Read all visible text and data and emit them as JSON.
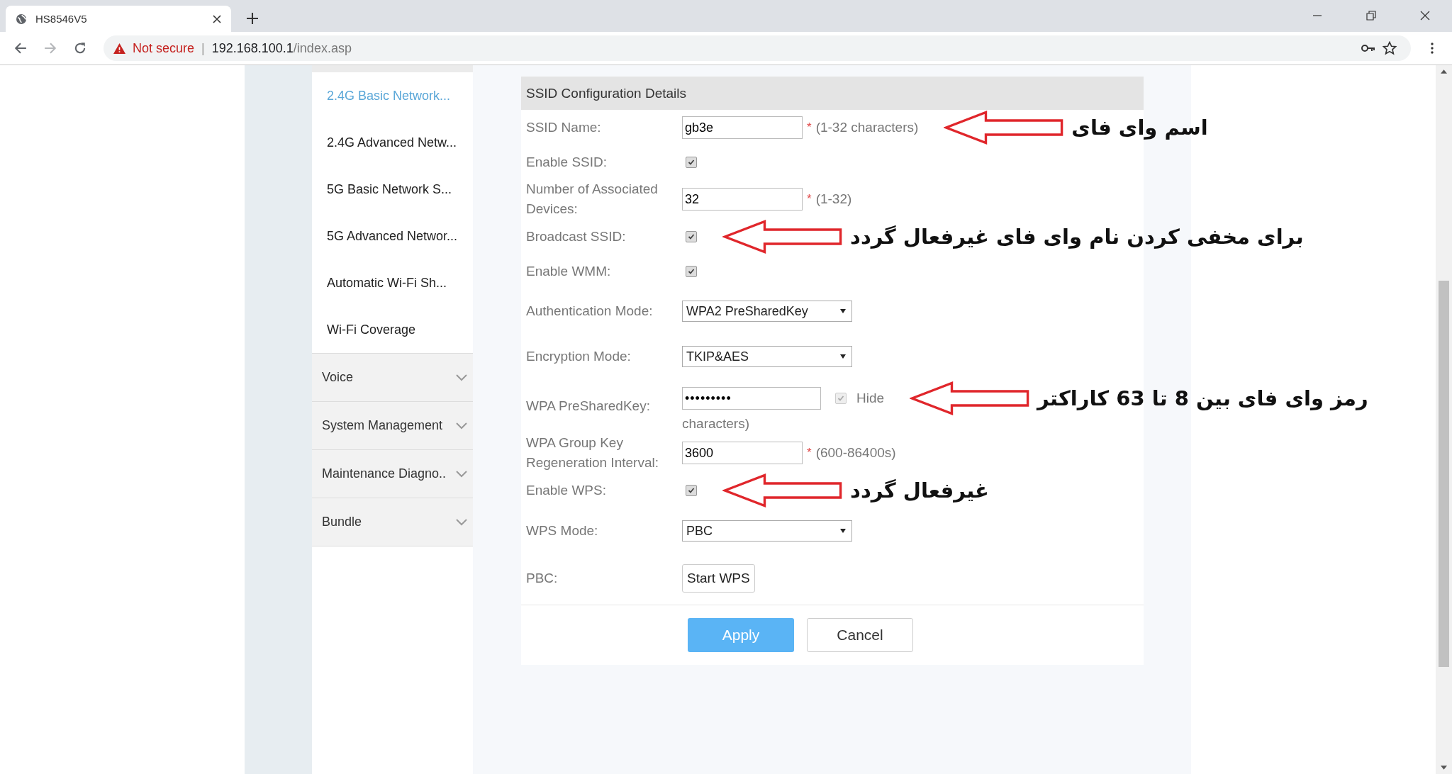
{
  "browser": {
    "tab_title": "HS8546V5",
    "security": "Not secure",
    "separator": "|",
    "url": {
      "host": "192.168.100.1",
      "path": "/index.asp"
    }
  },
  "sidebar": {
    "items": [
      {
        "label": "2.4G Basic Network...",
        "selected": true
      },
      {
        "label": "2.4G Advanced Netw...",
        "selected": false
      },
      {
        "label": "5G Basic Network S...",
        "selected": false
      },
      {
        "label": "5G Advanced Networ...",
        "selected": false
      },
      {
        "label": "Automatic Wi-Fi Sh...",
        "selected": false
      },
      {
        "label": "Wi-Fi Coverage",
        "selected": false
      }
    ],
    "groups": [
      {
        "label": "Voice",
        "expanded": false
      },
      {
        "label": "System Management",
        "expanded": false
      },
      {
        "label": "Maintenance Diagno..",
        "expanded": false
      },
      {
        "label": "Bundle",
        "expanded": false
      }
    ]
  },
  "form": {
    "title": "SSID Configuration Details",
    "fields": [
      {
        "kind": "text",
        "label": "SSID Name:",
        "value": "gb3e",
        "required": "*",
        "hint": "(1-32 characters)",
        "note": "اسم وای فای"
      },
      {
        "kind": "checkbox",
        "label": "Enable SSID:",
        "checked": true
      },
      {
        "kind": "text",
        "label": "Number of Associated Devices:",
        "value": "32",
        "required": "*",
        "hint": "(1-32)"
      },
      {
        "kind": "checkbox",
        "label": "Broadcast SSID:",
        "checked": true,
        "note": "برای مخفی کردن نام وای فای غیرفعال گردد"
      },
      {
        "kind": "checkbox",
        "label": "Enable WMM:",
        "checked": true
      },
      {
        "kind": "select",
        "label": "Authentication Mode:",
        "value": "WPA2 PreSharedKey"
      },
      {
        "kind": "select",
        "label": "Encryption Mode:",
        "value": "TKIP&AES"
      },
      {
        "kind": "password",
        "label": "WPA PreSharedKey:",
        "value": "•••••••••",
        "hide": {
          "label": "Hide",
          "checked": true
        },
        "hint": "characters)",
        "note": "رمز وای فای بین 8 تا 63 کاراکتر"
      },
      {
        "kind": "text",
        "label": "WPA Group Key Regeneration Interval:",
        "value": "3600",
        "required": "*",
        "hint": "(600-86400s)"
      },
      {
        "kind": "checkbox",
        "label": "Enable WPS:",
        "checked": true,
        "note": "غیرفعال گردد"
      },
      {
        "kind": "select",
        "label": "WPS Mode:",
        "value": "PBC"
      },
      {
        "kind": "button",
        "label": "PBC:",
        "value": "Start WPS"
      }
    ],
    "buttons": [
      {
        "kind": "primary",
        "label": "Apply"
      },
      {
        "kind": "secondary",
        "label": "Cancel"
      }
    ]
  }
}
